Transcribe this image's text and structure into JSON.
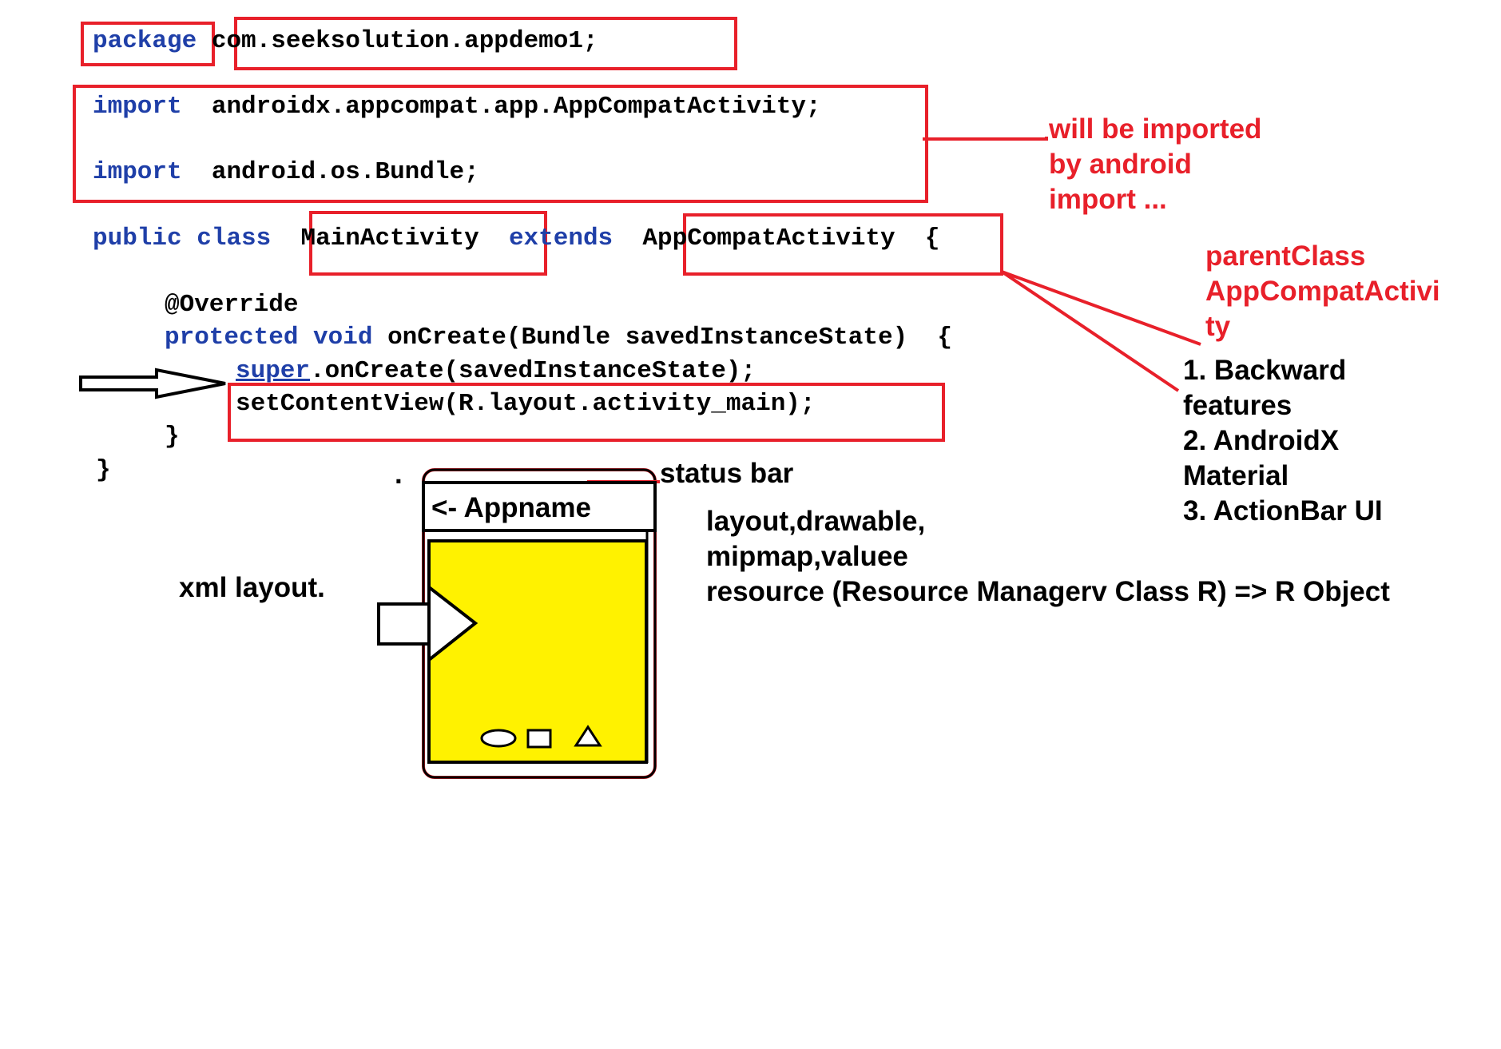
{
  "code": {
    "package_kw": "package",
    "package_name": "com.seeksolution.appdemo1;",
    "import_kw_1": "import",
    "import_1": "androidx.appcompat.app.AppCompatActivity",
    "import_1_semi": ";",
    "import_kw_2": "import",
    "import_2": "android.os.Bundle;",
    "public_kw": "public",
    "class_kw": "class",
    "class_name": "MainActivity",
    "extends_kw": "extends",
    "parent_class": "AppCompatActivity",
    "open_brace": "{",
    "override": "@Override",
    "protected_kw": "protected",
    "void_kw": "void",
    "method_sig": "onCreate(Bundle savedInstanceState)",
    "method_brace": "{",
    "super_kw": "super",
    "super_call": ".onCreate(savedInstanceState);",
    "set_content": "setContentView(R.layout.activity_main);",
    "close_method": "}",
    "close_class": "}"
  },
  "notes": {
    "imported": [
      "will be imported",
      "by android",
      "import ..."
    ],
    "parent": [
      "parentClass",
      "AppCompatActivi",
      "ty"
    ],
    "features": [
      "1. Backward",
      "features",
      "2. AndroidX",
      "Material",
      "3. ActionBar UI"
    ],
    "status_bar": "status bar",
    "resource": [
      "layout,drawable,",
      "mipmap,valuee",
      "resource (Resource Managerv Class R) => R Object"
    ],
    "xml_layout": "xml layout.",
    "dot": ".",
    "appname": "<- Appname"
  },
  "colors": {
    "annotation_red": "#e8202a",
    "keyword_blue": "#1f3fa8",
    "phone_screen_yellow": "#fff200"
  },
  "icons": [
    "arrow-right-outline-icon",
    "play-triangle-icon",
    "circle-nav-icon",
    "square-nav-icon",
    "triangle-nav-icon"
  ]
}
